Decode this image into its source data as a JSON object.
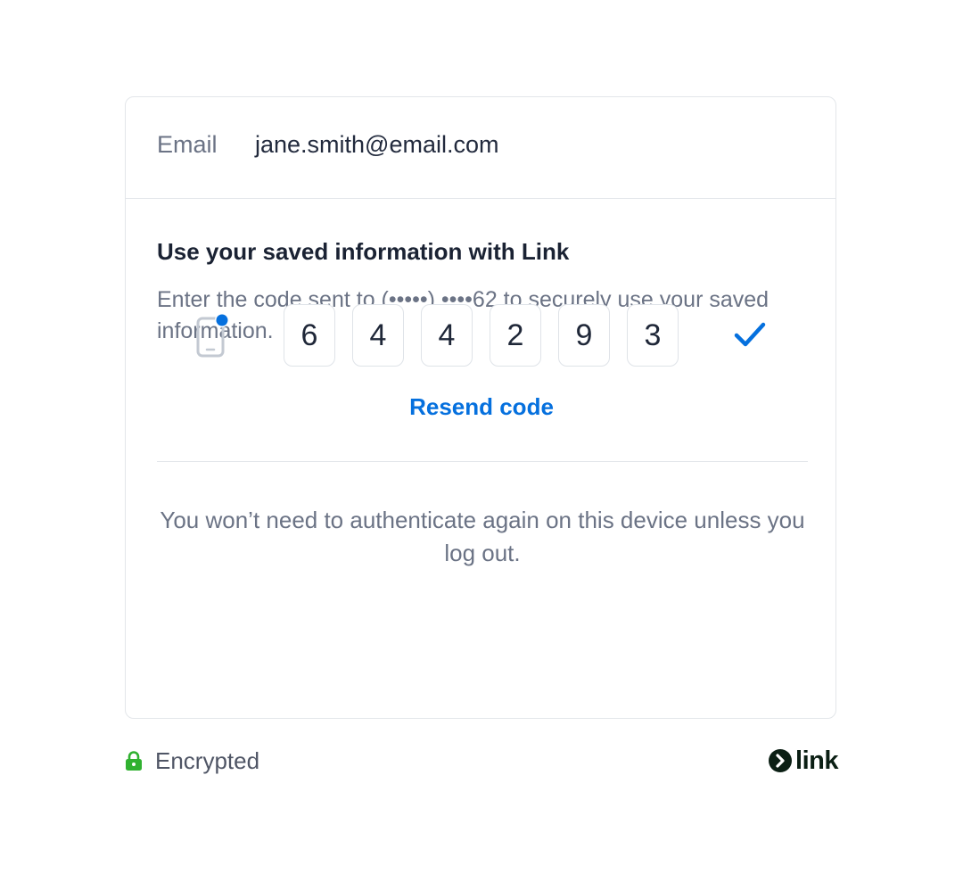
{
  "email": {
    "label": "Email",
    "value": "jane.smith@email.com"
  },
  "verification": {
    "heading": "Use your saved information with Link",
    "description": "Enter the code sent to (•••••) ••••62 to securely use your saved information.",
    "code_digits": [
      "6",
      "4",
      "4",
      "2",
      "9",
      "3"
    ],
    "resend_label": "Resend code",
    "note": "You won’t need to authenticate again on this device unless you log out."
  },
  "footer": {
    "encrypted_label": "Encrypted",
    "brand_name": "link"
  },
  "icons": {
    "phone": "phone-notification-icon",
    "check": "checkmark-icon",
    "lock": "lock-icon",
    "brand": "link-logo-icon"
  },
  "colors": {
    "accent": "#0570de",
    "success": "#30b130",
    "brand": "#0b1f14",
    "text_muted": "#6b7385",
    "text_primary": "#1a2233",
    "border": "#e3e6ea"
  }
}
